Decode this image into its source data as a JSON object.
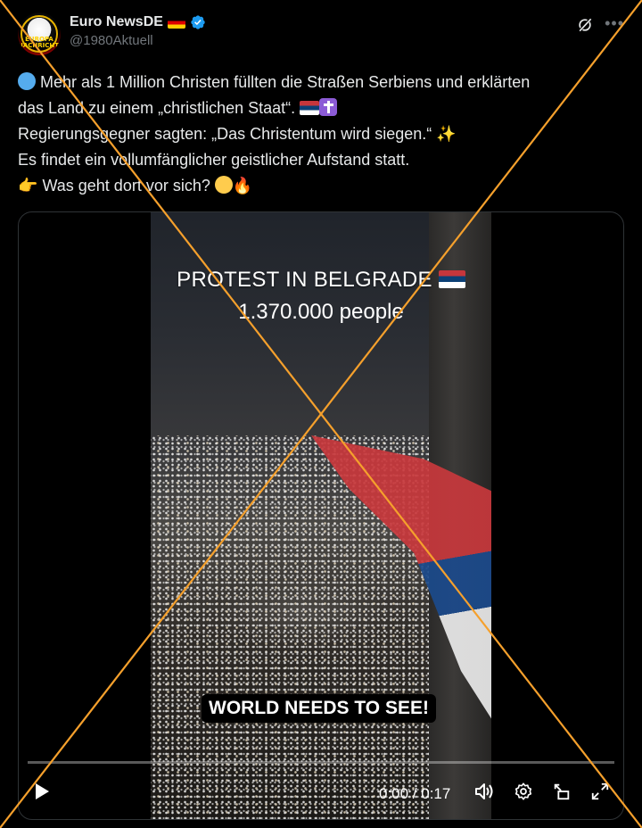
{
  "post": {
    "display_name": "Euro NewsDE",
    "handle": "@1980Aktuell",
    "avatar_text": "EUROPA NACHRICHTEN",
    "lines": [
      "Mehr als 1 Million Christen füllten die Straßen Serbiens und erklärten",
      "das Land zu einem „christlichen Staat“.",
      "Regierungsgegner sagten: „Das Christentum wird siegen.“",
      "Es findet ein vollumfänglicher geistlicher Aufstand statt.",
      "Was geht dort vor sich?"
    ]
  },
  "video": {
    "title": "PROTEST IN BELGRADE",
    "subtitle": "1.370.000 people",
    "caption": "WORLD NEEDS TO SEE!",
    "time": "0:00 / 0:17",
    "progress": 0
  },
  "icons": {
    "grok": "grok-icon",
    "more": "more-icon",
    "play": "play-icon",
    "volume": "volume-icon",
    "settings": "gear-icon",
    "pip": "picture-in-picture-icon",
    "fullscreen": "fullscreen-icon"
  },
  "colors": {
    "background": "#000000",
    "text": "#e7e9ea",
    "muted": "#71767b",
    "verified": "#1d9bf0",
    "cross_overlay": "#f5a02c"
  }
}
